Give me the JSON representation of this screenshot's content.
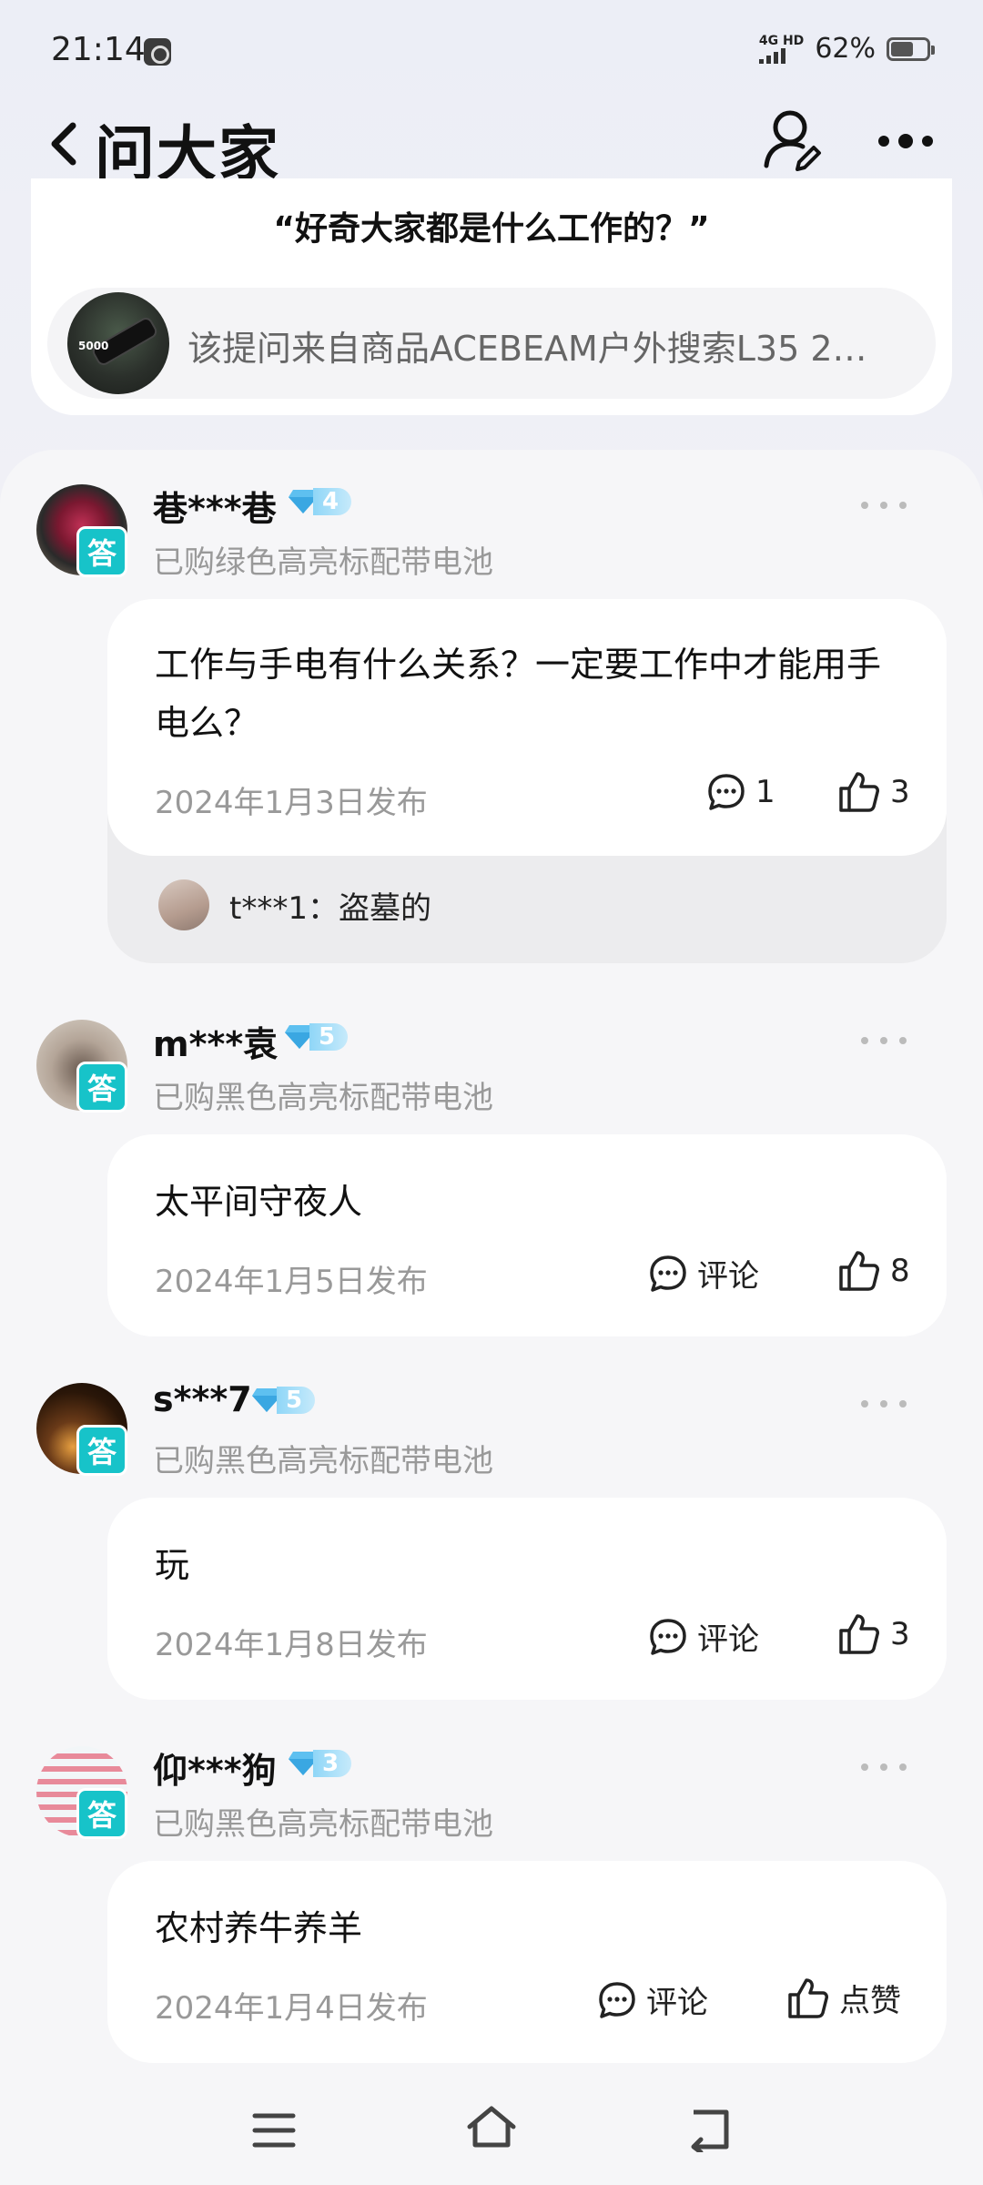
{
  "status_bar": {
    "time": "21:14",
    "network": "4G HD",
    "battery_percent": "62%",
    "battery_level": 0.62
  },
  "header": {
    "title": "问大家"
  },
  "question": {
    "text": "“好奇大家都是什么工作的？”",
    "source": "该提问来自商品ACEBEAM户外搜索L35 2…"
  },
  "answers": [
    {
      "user": "巷***巷",
      "level": "4",
      "badge": "答",
      "purchase": "已购绿色高亮标配带电池",
      "text": "工作与手电有什么关系？一定要工作中才能用手电么？",
      "date": "2024年1月3日发布",
      "comment_label": "1",
      "like_label": "3",
      "reply": "t***1：盗墓的"
    },
    {
      "user": "m***袁",
      "level": "5",
      "badge": "答",
      "purchase": "已购黑色高亮标配带电池",
      "text": "太平间守夜人",
      "date": "2024年1月5日发布",
      "comment_label": "评论",
      "like_label": "8"
    },
    {
      "user": "s***7",
      "level": "5",
      "badge": "答",
      "purchase": "已购黑色高亮标配带电池",
      "text": "玩",
      "date": "2024年1月8日发布",
      "comment_label": "评论",
      "like_label": "3"
    },
    {
      "user": "仰***狗",
      "level": "3",
      "badge": "答",
      "purchase": "已购黑色高亮标配带电池",
      "text": "农村养牛养羊",
      "date": "2024年1月4日发布",
      "comment_label": "评论",
      "like_label": "点赞"
    }
  ],
  "colors": {
    "answer_badge": "#17c3c9",
    "level_badge": "#8fd6f7",
    "text_secondary": "#999999"
  },
  "icons": [
    "back-icon",
    "user-search-icon",
    "more-icon",
    "comment-icon",
    "thumbs-up-icon",
    "menu-icon",
    "home-icon",
    "nav-back-icon"
  ]
}
